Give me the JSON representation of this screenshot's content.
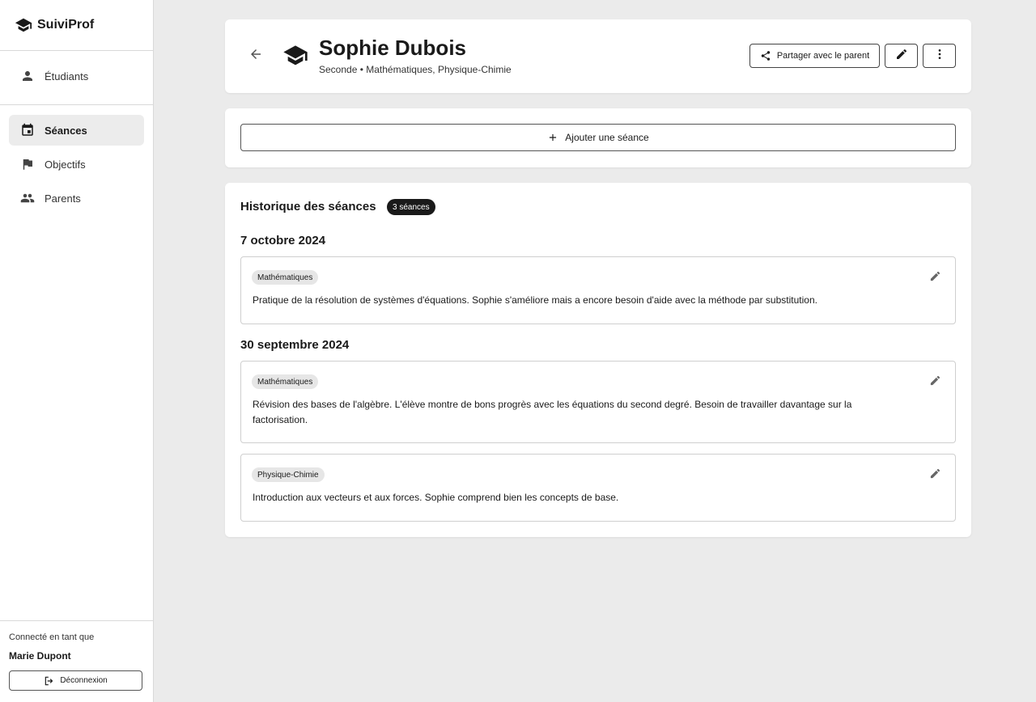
{
  "app": {
    "name": "SuiviProf"
  },
  "sidebar": {
    "top_items": [
      {
        "label": "Étudiants",
        "icon": "person-icon"
      }
    ],
    "items": [
      {
        "label": "Séances",
        "icon": "calendar-icon",
        "active": true
      },
      {
        "label": "Objectifs",
        "icon": "flag-icon"
      },
      {
        "label": "Parents",
        "icon": "people-icon"
      }
    ],
    "footer": {
      "connected_label": "Connecté en tant que",
      "user_name": "Marie Dupont",
      "logout_label": "Déconnexion"
    }
  },
  "student": {
    "name": "Sophie Dubois",
    "subtitle": "Seconde • Mathématiques, Physique-Chimie",
    "share_label": "Partager avec le parent"
  },
  "actions": {
    "add_session_label": "Ajouter une séance"
  },
  "history": {
    "title": "Historique des séances",
    "count": "3 séances",
    "groups": [
      {
        "date": "7 octobre 2024",
        "sessions": [
          {
            "subject": "Mathématiques",
            "text": "Pratique de la résolution de systèmes d'équations. Sophie s'améliore mais a encore besoin d'aide avec la méthode par substitution."
          }
        ]
      },
      {
        "date": "30 septembre 2024",
        "sessions": [
          {
            "subject": "Mathématiques",
            "text": "Révision des bases de l'algèbre. L'élève montre de bons progrès avec les équations du second degré. Besoin de travailler davantage sur la factorisation."
          },
          {
            "subject": "Physique-Chimie",
            "text": "Introduction aux vecteurs et aux forces. Sophie comprend bien les concepts de base."
          }
        ]
      }
    ]
  },
  "colors": {
    "background": "#ebebeb",
    "active_nav": "#ececec",
    "badge": "#1a1a1a",
    "tag": "#e6e6e6"
  }
}
